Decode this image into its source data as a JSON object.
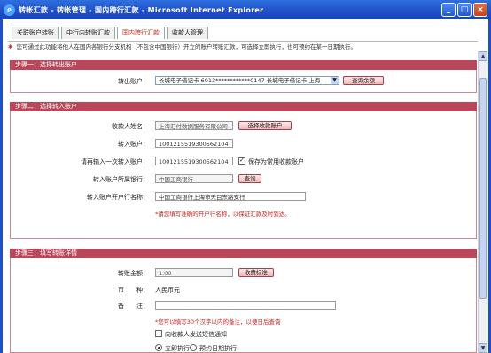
{
  "window": {
    "title": "转帐汇款 - 转帐管理 - 国内跨行汇款 - Microsoft Internet Explorer",
    "icon": "ie-icon",
    "minimize": "_",
    "maximize": "□",
    "close": "×"
  },
  "tabs": [
    {
      "label": "关联账户转账",
      "active": false
    },
    {
      "label": "中行内转账汇款",
      "active": false
    },
    {
      "label": "国内跨行汇款",
      "active": true
    },
    {
      "label": "收款人管理",
      "active": false
    }
  ],
  "notice": "您可通过此功能将他人在国内各银行分支机构（不包含中国银行）开立的账户转账汇款，可选择立即执行，也可预约在某一日期执行。",
  "section1": {
    "title": "步骤一：选择转出账户",
    "from_account_label": "转出账户：",
    "from_account_value": "长城电子借记卡 6013************0147 长城电子借记卡 上海",
    "query_balance_btn": "查询余额"
  },
  "section2": {
    "title": "步骤二：选择转入账户",
    "payee_name_label": "收款人姓名：",
    "payee_name_value": "上海汇付数据服务有限公司",
    "select_payee_btn": "选择收款账户",
    "to_account_label": "转入账户：",
    "to_account_value": "1001215519300562104",
    "confirm_account_label": "请再输入一次转入账户：",
    "confirm_account_value": "1001215519300562104",
    "save_payee_label": "保存为常用收款账户",
    "save_payee_checked": true,
    "bank_label": "转入账户所属银行：",
    "bank_value": "中国工商银行",
    "query_btn": "查询",
    "branch_label": "转入账户开户行名称：",
    "branch_value": "中国工商银行上海市天目东路支行",
    "branch_hint": "*请您填写准确的开户行名称，以保证汇款及时到达。"
  },
  "section3": {
    "title": "步骤三：填写转账详情",
    "amount_label": "转账金额：",
    "amount_value": "1.00",
    "fee_btn": "收费标准",
    "currency_label": "币　　种：",
    "currency_value": "人民币元",
    "memo_label": "备　　注：",
    "memo_value": "",
    "memo_hint": "*您可以填写30个汉字以内的备注，以便日后查询",
    "sms_label": "向收款人发送短信通知",
    "sms_checked": false,
    "exec_now_label": "立即执行",
    "exec_scheduled_label": "预约日期执行",
    "exec_mode": "now"
  },
  "colors": {
    "title_bar": "#1f4fc6",
    "section_header": "#b8475a",
    "hint_red": "#d02020"
  }
}
